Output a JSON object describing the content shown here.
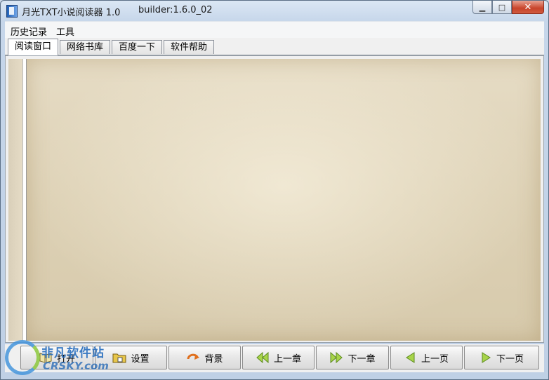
{
  "window": {
    "title": "月光TXT小说阅读器 1.0",
    "build": "builder:1.6.0_02",
    "controls": {
      "minimize": "▁",
      "maximize": "□",
      "close": "✕"
    }
  },
  "menu": {
    "items": [
      "历史记录",
      "工具"
    ]
  },
  "tabs": {
    "items": [
      "阅读窗口",
      "网络书库",
      "百度一下",
      "软件帮助"
    ],
    "active_index": 0
  },
  "toolbar": {
    "buttons": [
      {
        "label": "打开",
        "icon": "open-book-icon"
      },
      {
        "label": "设置",
        "icon": "folder-settings-icon"
      },
      {
        "label": "背景",
        "icon": "refresh-arrow-icon"
      },
      {
        "label": "上一章",
        "icon": "double-left-arrow-icon"
      },
      {
        "label": "下一章",
        "icon": "double-right-arrow-icon"
      },
      {
        "label": "上一页",
        "icon": "left-triangle-icon"
      },
      {
        "label": "下一页",
        "icon": "right-triangle-icon"
      }
    ]
  },
  "watermark": {
    "cn": "非凡软件站",
    "en": "CRSKY.com"
  },
  "colors": {
    "paper": "#e2d7be",
    "accent_blue": "#1f5fb4",
    "arrow_green": "#9ccc3c",
    "arrow_orange": "#e0701e"
  }
}
